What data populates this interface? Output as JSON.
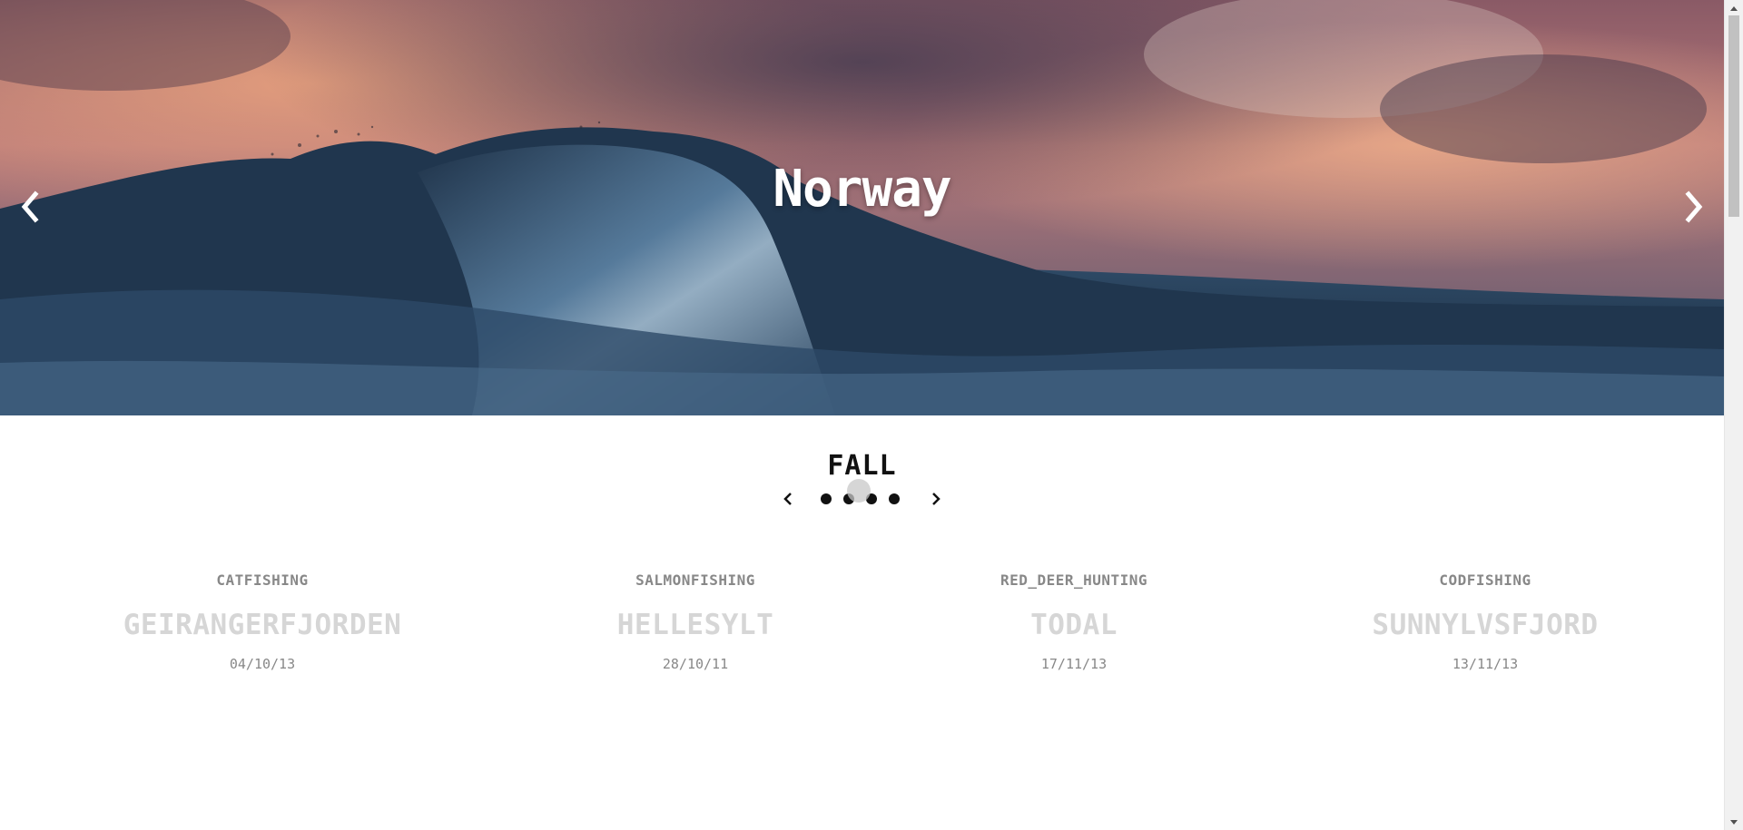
{
  "hero": {
    "title": "Norway",
    "prev_icon": "chevron-left-icon",
    "next_icon": "chevron-right-icon"
  },
  "season": {
    "title": "FALL",
    "prev_icon": "chevron-left-icon",
    "next_icon": "chevron-right-icon",
    "dot_count": 4
  },
  "cards": [
    {
      "activity": "CATFISHING",
      "place": "GEIRANGERFJORDEN",
      "date": "04/10/13"
    },
    {
      "activity": "SALMONFISHING",
      "place": "HELLESYLT",
      "date": "28/10/11"
    },
    {
      "activity": "RED_DEER_HUNTING",
      "place": "TODAL",
      "date": "17/11/13"
    },
    {
      "activity": "CODFISHING",
      "place": "SUNNYLVSFJORD",
      "date": "13/11/13"
    }
  ],
  "colors": {
    "activity_text": "#888888",
    "place_text": "#d6d6d6",
    "date_text": "#888888",
    "season_text": "#111111"
  }
}
